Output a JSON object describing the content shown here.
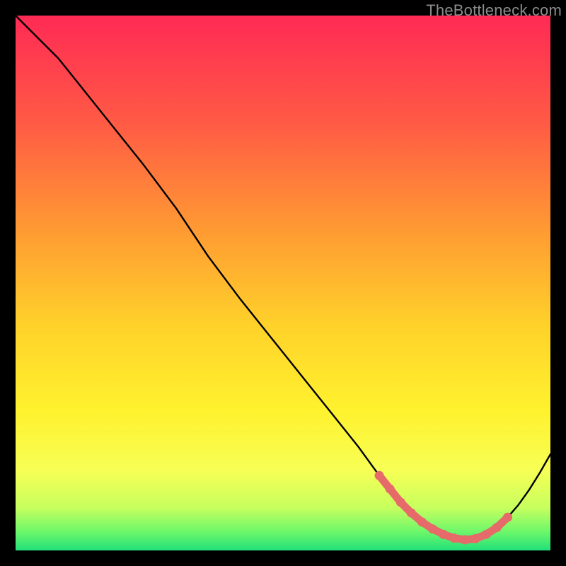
{
  "watermark": "TheBottleneck.com",
  "chart_data": {
    "type": "line",
    "title": "",
    "xlabel": "",
    "ylabel": "",
    "xlim": [
      0,
      100
    ],
    "ylim": [
      0,
      100
    ],
    "grid": false,
    "series": [
      {
        "name": "curve",
        "color": "#000000",
        "x": [
          0,
          4,
          8,
          12,
          16,
          20,
          24,
          30,
          36,
          42,
          48,
          54,
          60,
          64,
          68,
          70,
          72,
          74,
          76,
          78,
          80,
          82,
          84,
          86,
          88,
          90,
          92,
          94,
          96,
          98,
          100
        ],
        "y": [
          100,
          96,
          92,
          87,
          82,
          77,
          72,
          64,
          55,
          47,
          39.5,
          32,
          24.5,
          19.5,
          14,
          11.5,
          9,
          7,
          5.3,
          4,
          3,
          2.3,
          2,
          2.2,
          3,
          4.3,
          6.2,
          8.5,
          11.3,
          14.5,
          18
        ]
      },
      {
        "name": "highlight-dots",
        "color": "#e66a6a",
        "x": [
          68,
          70,
          72,
          74,
          76,
          78,
          80,
          82,
          84,
          86,
          88,
          90,
          92
        ],
        "y": [
          14,
          11.5,
          9,
          7,
          5.3,
          4,
          3,
          2.3,
          2,
          2.2,
          3,
          4.3,
          6.2
        ]
      }
    ],
    "background_gradient": {
      "stops": [
        {
          "offset": 0.0,
          "color": "#ff2a55"
        },
        {
          "offset": 0.2,
          "color": "#ff5a45"
        },
        {
          "offset": 0.4,
          "color": "#ff9a33"
        },
        {
          "offset": 0.58,
          "color": "#ffd22a"
        },
        {
          "offset": 0.74,
          "color": "#fff22e"
        },
        {
          "offset": 0.85,
          "color": "#f7ff55"
        },
        {
          "offset": 0.92,
          "color": "#c7ff5e"
        },
        {
          "offset": 0.965,
          "color": "#6cf76a"
        },
        {
          "offset": 1.0,
          "color": "#22e07a"
        }
      ]
    }
  }
}
